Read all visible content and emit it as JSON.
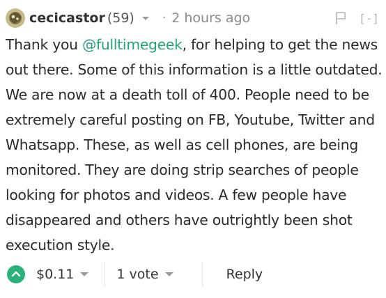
{
  "comment": {
    "author": "cecicastor",
    "reputation": "(59)",
    "separator": "·",
    "timestamp": "2 hours ago",
    "collapse_label": "[-]",
    "body": {
      "intro": "Thank you ",
      "mention": "@fulltimegeek",
      "text": ", for helping to get the news out there. Some of this information is a little outdated. We are now at a death toll of 400. People need to be extremely careful posting on FB, Youtube, Twitter and Whatsapp. These, as well as cell phones, are being monitored. They are doing strip searches of people looking for photos and videos. A few people have disappeared and others have outrightly been shot execution style."
    },
    "footer": {
      "payout": "$0.11",
      "votes": "1 vote",
      "reply_label": "Reply"
    }
  },
  "colors": {
    "accent": "#2ab27b",
    "mention": "#24a37a",
    "meta": "#8a8a8a"
  },
  "icons": {
    "avatar": "avatar-image",
    "author_caret": "chevron-down-icon",
    "flag": "flag-icon",
    "upvote": "upvote-chevron-icon",
    "payout_caret": "caret-down-icon",
    "votes_caret": "caret-down-icon"
  }
}
